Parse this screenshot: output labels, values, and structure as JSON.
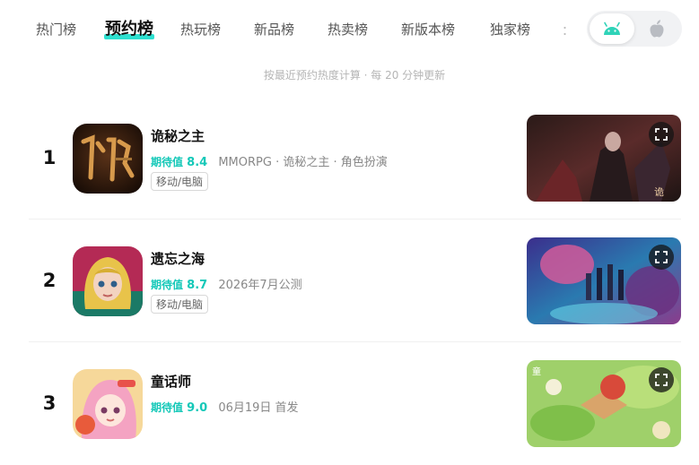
{
  "tabs": [
    {
      "label": "热门榜",
      "active": false
    },
    {
      "label": "预约榜",
      "active": true
    },
    {
      "label": "热玩榜",
      "active": false
    },
    {
      "label": "新品榜",
      "active": false
    },
    {
      "label": "热卖榜",
      "active": false
    },
    {
      "label": "新版本榜",
      "active": false
    },
    {
      "label": "独家榜",
      "active": false
    }
  ],
  "tab_more": "：",
  "platforms": {
    "selected": "android",
    "options": [
      "android-icon",
      "apple-icon"
    ]
  },
  "subtitle": "按最近预约热度计算 · 每 20 分钟更新",
  "colors": {
    "accent": "#14c8b8",
    "tab_highlight": "#2ee0d0",
    "android": "#2fd3b8"
  },
  "games": [
    {
      "rank": "1",
      "name": "诡秘之主",
      "score_label": "期待值",
      "score": "8.4",
      "meta": "MMORPG · 诡秘之主 · 角色扮演",
      "tag": "移动/电脑"
    },
    {
      "rank": "2",
      "name": "遗忘之海",
      "score_label": "期待值",
      "score": "8.7",
      "meta": "2026年7月公测",
      "tag": "移动/电脑"
    },
    {
      "rank": "3",
      "name": "童话师",
      "score_label": "期待值",
      "score": "9.0",
      "meta": "06月19日 首发",
      "tag": ""
    }
  ]
}
